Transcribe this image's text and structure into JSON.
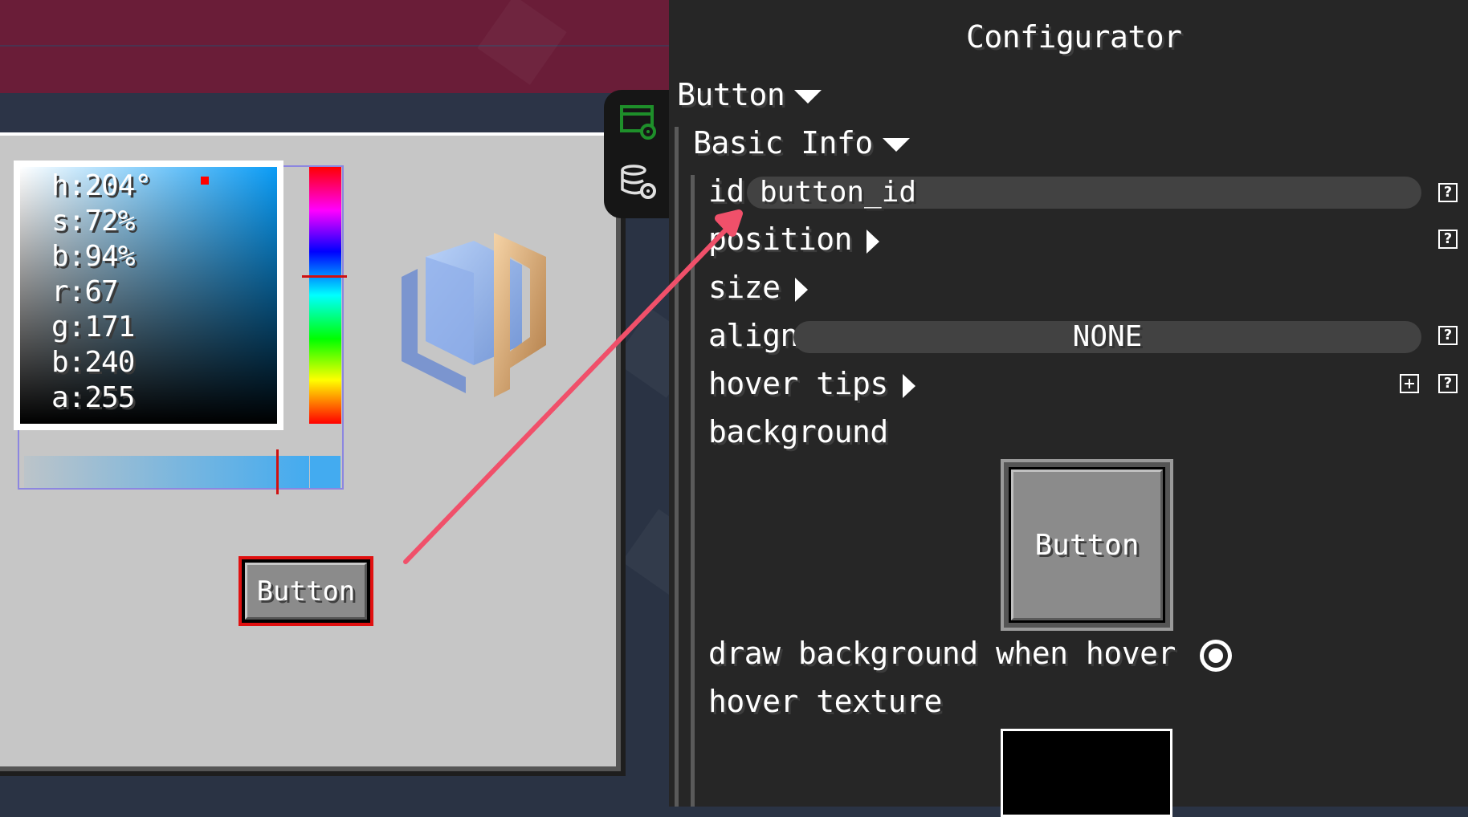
{
  "colors": {
    "panel": "#c6c6c6",
    "banner": "#6a1d38",
    "configurator_bg": "#262626",
    "field_bg": "#424242",
    "selection_red": "#e01010",
    "arrow": "#f0506a",
    "picked_color": "#43abf0"
  },
  "color_picker": {
    "h": "h:204°",
    "s": "s:72%",
    "b": "b:94%",
    "r": "r:67",
    "g": "g:171",
    "b2": "b:240",
    "a": "a:255"
  },
  "canvas": {
    "button_label": "Button",
    "logo_icon": "ldlib-cube-logo-icon"
  },
  "tool_tabs": [
    {
      "icon": "window-settings-icon",
      "active": true
    },
    {
      "icon": "database-settings-icon",
      "active": false
    }
  ],
  "configurator": {
    "title": "Configurator",
    "root_label": "Button",
    "section_label": "Basic Info",
    "id_label": "id",
    "id_value": "button_id",
    "position_label": "position",
    "size_label": "size",
    "align_label": "align",
    "align_value": "NONE",
    "hover_tips_label": "hover tips",
    "background_label": "background",
    "background_preview_label": "Button",
    "draw_bg_hover_label": "draw background when hover",
    "draw_bg_hover_checked": true,
    "hover_texture_label": "hover texture",
    "help_glyph": "?"
  }
}
